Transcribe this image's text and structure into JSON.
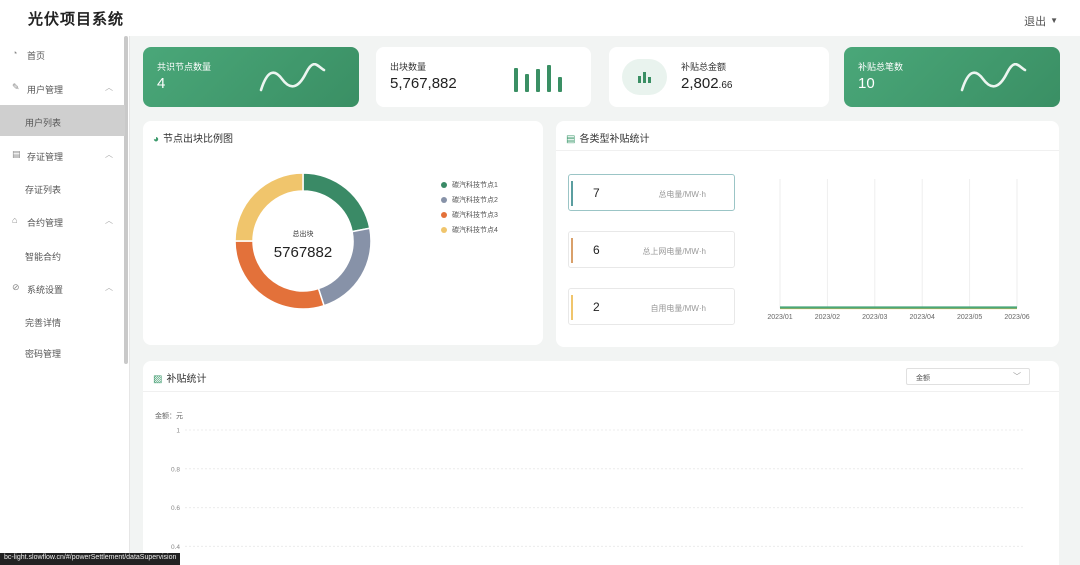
{
  "header": {
    "app_title": "光伏项目系统",
    "logout_label": "退出"
  },
  "sidebar": {
    "items": [
      {
        "label": "首页",
        "icon": "dashboard-icon"
      },
      {
        "label": "用户管理",
        "icon": "edit-icon"
      },
      {
        "label": "用户列表"
      },
      {
        "label": "存证管理",
        "icon": "document-icon"
      },
      {
        "label": "存证列表"
      },
      {
        "label": "合约管理",
        "icon": "contract-icon"
      },
      {
        "label": "智能合约"
      },
      {
        "label": "系统设置",
        "icon": "settings-icon"
      },
      {
        "label": "完善详情"
      },
      {
        "label": "密码管理"
      }
    ]
  },
  "stats": [
    {
      "label": "共识节点数量",
      "value": "4",
      "style": "green"
    },
    {
      "label": "出块数量",
      "value": "5,767,882",
      "style": "white"
    },
    {
      "label": "补贴总金额",
      "value": "2,802",
      "decimals": ".66",
      "style": "white"
    },
    {
      "label": "补贴总笔数",
      "value": "10",
      "style": "green"
    }
  ],
  "node_panel": {
    "title": "节点出块比例图",
    "center_label": "总出块",
    "center_value": "5767882"
  },
  "subsidy_type_panel": {
    "title": "各类型补贴统计",
    "boxes": [
      {
        "value": "7",
        "unit": "总电量/MW·h",
        "color": "#5b9ea0"
      },
      {
        "value": "6",
        "unit": "总上网电量/MW·h",
        "color": "#d9a06a"
      },
      {
        "value": "2",
        "unit": "自用电量/MW·h",
        "color": "#f0c56c"
      }
    ]
  },
  "subsidy_panel": {
    "title": "补贴统计",
    "select_value": "金额",
    "y_axis_name": "金额：元"
  },
  "status_url": "bc-light.slowflow.cn/#/powerSettlement/dataSupervision",
  "chart_data": [
    {
      "type": "pie",
      "variant": "donut",
      "categories": [
        "碳汽科技节点1",
        "碳汽科技节点2",
        "碳汽科技节点3",
        "碳汽科技节点4"
      ],
      "values": [
        22,
        23,
        30,
        25
      ],
      "colors": [
        "#3a8a66",
        "#8792a8",
        "#e3713a",
        "#f0c56c"
      ]
    },
    {
      "type": "line",
      "categories": [
        "2023/01",
        "2023/02",
        "2023/03",
        "2023/04",
        "2023/05",
        "2023/06"
      ],
      "series": [
        {
          "values": [
            0,
            0,
            0,
            0,
            0,
            0
          ],
          "color": "#e3b64a"
        },
        {
          "values": [
            0,
            0,
            0,
            0,
            0,
            0
          ],
          "color": "#4aa779"
        }
      ],
      "grid": "vertical"
    },
    {
      "type": "line",
      "ylabel": "金额：元",
      "y_ticks": [
        "1",
        "0.8",
        "0.6",
        "0.4"
      ],
      "ylim": [
        0,
        1
      ]
    }
  ]
}
